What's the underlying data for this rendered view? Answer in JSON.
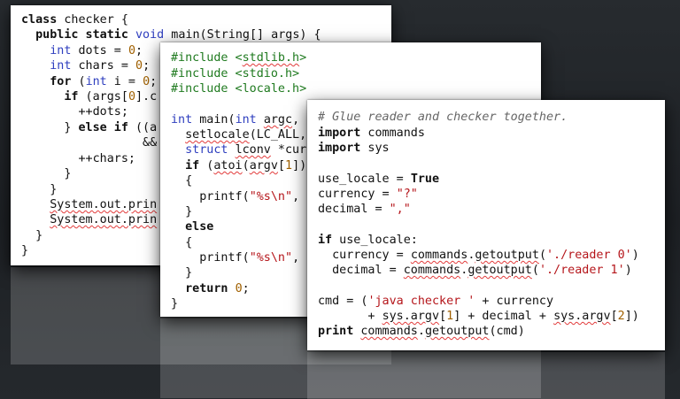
{
  "java": {
    "lines": [
      "class checker {",
      "  public static void main(String[] args) {",
      "    int dots = 0;",
      "    int chars = 0;",
      "    for (int i = 0;",
      "      if (args[0].c",
      "        ++dots;",
      "      } else if ((a",
      "                 &&",
      "        ++chars;",
      "      }",
      "    }",
      "    System.out.prin",
      "    System.out.prin",
      "  }",
      "}"
    ]
  },
  "c": {
    "lines": [
      "#include <stdlib.h>",
      "#include <stdio.h>",
      "#include <locale.h>",
      "",
      "int main(int argc,",
      "  setlocale(LC_ALL,",
      "  struct lconv *cur",
      "  if (atoi(argv[1])",
      "  {",
      "    printf(\"%s\\n\",",
      "  }",
      "  else",
      "  {",
      "    printf(\"%s\\n\",",
      "  }",
      "  return 0;",
      "}"
    ]
  },
  "python": {
    "lines": [
      "# Glue reader and checker together.",
      "import commands",
      "import sys",
      "",
      "use_locale = True",
      "currency = \"?\"",
      "decimal = \",\"",
      "",
      "if use_locale:",
      "  currency = commands.getoutput('./reader 0')",
      "  decimal = commands.getoutput('./reader 1')",
      "",
      "cmd = ('java checker ' + currency",
      "       + sys.argv[1] + decimal + sys.argv[2])",
      "print commands.getoutput(cmd)"
    ]
  },
  "colors": {
    "keyword": "#111111",
    "type": "#2f3fbf",
    "number": "#a06000",
    "string": "#b5161b",
    "comment": "#666666",
    "preprocessor": "#1f7a1f",
    "background": "#1d2024"
  }
}
